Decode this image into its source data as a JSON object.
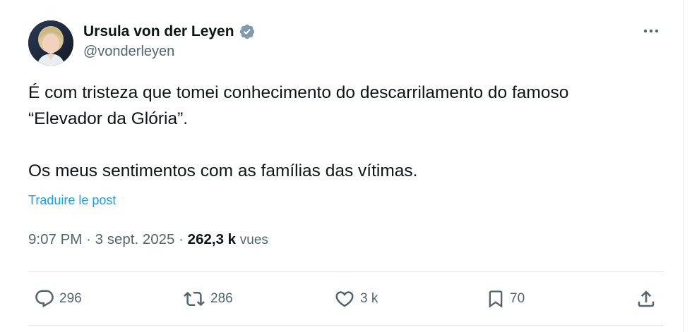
{
  "tweet": {
    "author": {
      "display_name": "Ursula von der Leyen",
      "handle": "@vonderleyen",
      "verified_icon": "verified-badge-icon"
    },
    "text_lines": [
      "É com tristeza que tomei conhecimento do descarrilamento do famoso",
      "“Elevador da Glória”.",
      "",
      "Os meus sentimentos com as famílias das vítimas."
    ],
    "translate_label": "Traduire le post",
    "meta": {
      "time": "9:07 PM",
      "separator": "·",
      "date": "3 sept. 2025",
      "views_count": "262,3 k",
      "views_label": "vues"
    },
    "actions": {
      "replies": "296",
      "reposts": "286",
      "likes": "3 k",
      "bookmarks": "70"
    },
    "colors": {
      "text": "#0f1419",
      "secondary": "#536471",
      "link": "#1d9bf0",
      "verified": "#829aab",
      "divider": "#e6e9ec"
    }
  }
}
